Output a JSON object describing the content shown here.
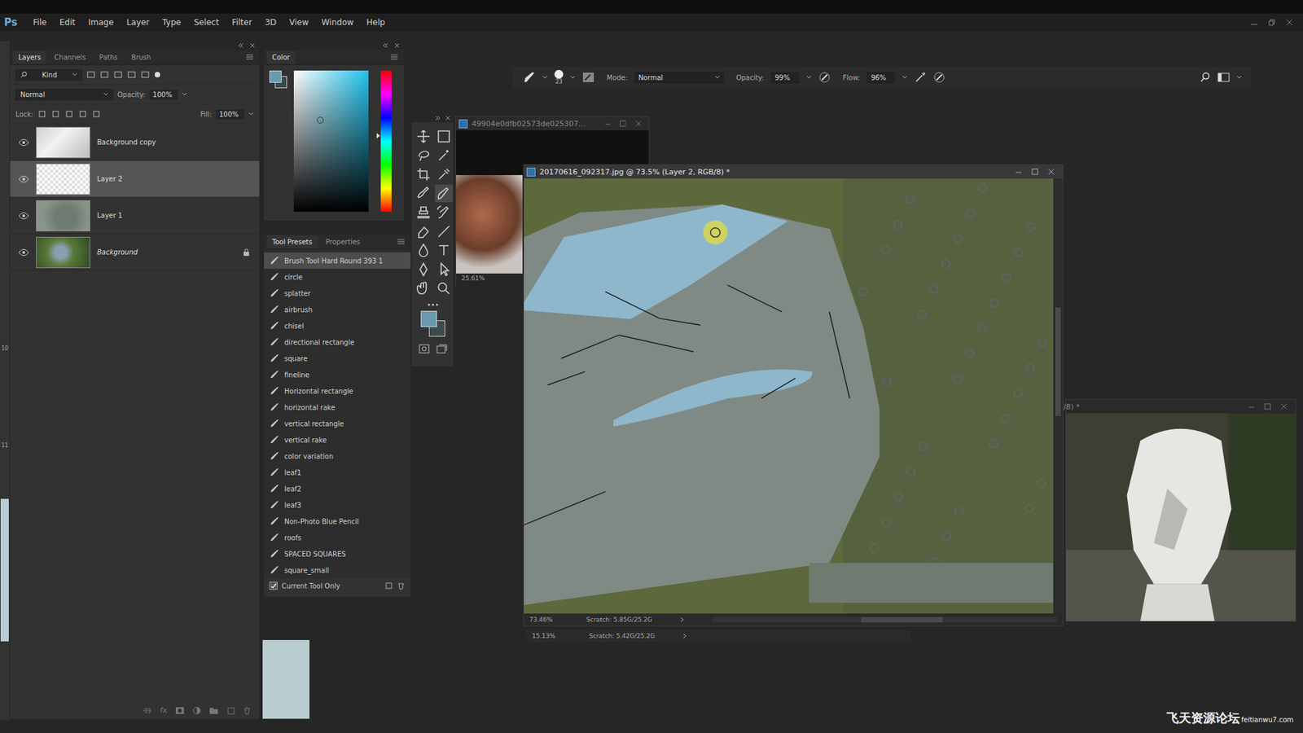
{
  "app": {
    "logo": "Ps"
  },
  "menu": [
    "File",
    "Edit",
    "Image",
    "Layer",
    "Type",
    "Select",
    "Filter",
    "3D",
    "View",
    "Window",
    "Help"
  ],
  "left_strip": [
    "10",
    "11"
  ],
  "layers_panel": {
    "tabs": [
      {
        "label": "Layers",
        "selected": true
      },
      {
        "label": "Channels",
        "selected": false
      },
      {
        "label": "Paths",
        "selected": false
      },
      {
        "label": "Brush",
        "selected": false
      }
    ],
    "filter": "Kind",
    "blend_mode": "Normal",
    "opacity_label": "Opacity:",
    "opacity": "100%",
    "lock_label": "Lock:",
    "fill_label": "Fill:",
    "fill": "100%",
    "layers": [
      {
        "name": "Background copy",
        "visible": true,
        "selected": false,
        "locked": false,
        "italic": false,
        "kind": "sketch"
      },
      {
        "name": "Layer 2",
        "visible": true,
        "selected": true,
        "locked": false,
        "italic": false,
        "kind": "transparent"
      },
      {
        "name": "Layer 1",
        "visible": true,
        "selected": false,
        "locked": false,
        "italic": false,
        "kind": "mask"
      },
      {
        "name": "Background",
        "visible": true,
        "selected": false,
        "locked": true,
        "italic": true,
        "kind": "photo"
      }
    ],
    "footer_fx": "fx"
  },
  "color_panel": {
    "title": "Color"
  },
  "tool_presets": {
    "tabs": [
      {
        "label": "Tool Presets",
        "selected": true
      },
      {
        "label": "Properties",
        "selected": false
      }
    ],
    "items": [
      {
        "label": "Brush Tool Hard Round 393 1",
        "selected": true
      },
      {
        "label": "circle",
        "selected": false
      },
      {
        "label": "splatter",
        "selected": false
      },
      {
        "label": "airbrush",
        "selected": false
      },
      {
        "label": "chisel",
        "selected": false
      },
      {
        "label": "directional rectangle",
        "selected": false
      },
      {
        "label": "square",
        "selected": false
      },
      {
        "label": "fineline",
        "selected": false
      },
      {
        "label": "Horizontal rectangle",
        "selected": false
      },
      {
        "label": "horizontal rake",
        "selected": false
      },
      {
        "label": "vertical rectangle",
        "selected": false
      },
      {
        "label": "vertical rake",
        "selected": false
      },
      {
        "label": "color variation",
        "selected": false
      },
      {
        "label": "leaf1",
        "selected": false
      },
      {
        "label": "leaf2",
        "selected": false
      },
      {
        "label": "leaf3",
        "selected": false
      },
      {
        "label": "Non-Photo Blue Pencil",
        "selected": false
      },
      {
        "label": "roofs",
        "selected": false
      },
      {
        "label": "SPACED SQUARES",
        "selected": false
      },
      {
        "label": "square_small",
        "selected": false
      }
    ],
    "current_tool_only": {
      "label": "Current Tool Only",
      "checked": true
    }
  },
  "options_bar": {
    "brush_size": "23",
    "mode_label": "Mode:",
    "mode": "Normal",
    "opacity_label": "Opacity:",
    "opacity": "99%",
    "flow_label": "Flow:",
    "flow": "96%"
  },
  "back_document": {
    "title": "49904e0dfb02573de025307...",
    "zoom": "25.61%"
  },
  "main_document": {
    "title": "20170616_092317.jpg @ 73.5% (Layer 2, RGB/8) *",
    "zoom": "73.46%",
    "scratch": "Scratch: 5.85G/25.2G"
  },
  "status_strip": {
    "zoom": "15.13%",
    "scratch": "Scratch: 5.42G/25.2G"
  },
  "side_document": {
    "title": "/8) *"
  },
  "watermark": {
    "text": "飞天资源论坛",
    "url": "feitianwu7.com"
  }
}
